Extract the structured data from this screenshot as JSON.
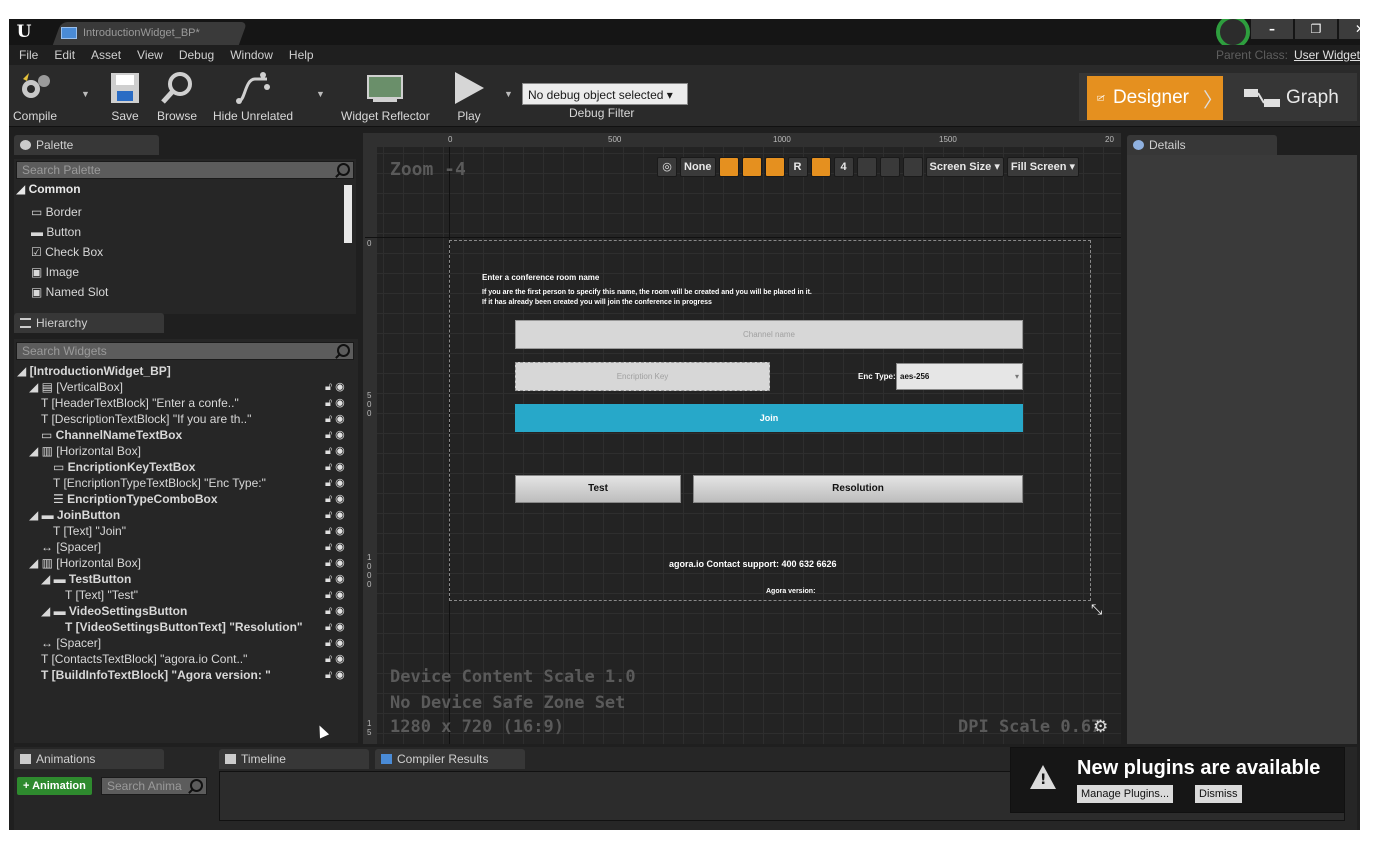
{
  "window": {
    "doc_tab": "IntroductionWidget_BP*",
    "controls": [
      "–",
      "❐",
      "✕"
    ]
  },
  "menu": [
    "File",
    "Edit",
    "Asset",
    "View",
    "Debug",
    "Window",
    "Help"
  ],
  "parent_class": {
    "label": "Parent Class:",
    "value": "User Widget"
  },
  "toolbar": {
    "compile": "Compile",
    "save": "Save",
    "browse": "Browse",
    "hide_unrelated": "Hide Unrelated",
    "widget_reflector": "Widget Reflector",
    "play": "Play",
    "debug_select": "No debug object selected ▾",
    "debug_filter": "Debug Filter",
    "designer": "Designer",
    "graph": "Graph"
  },
  "palette": {
    "tab": "Palette",
    "search_placeholder": "Search Palette",
    "category": "◢ Common",
    "items": [
      "▭ Border",
      "▬ Button",
      "☑ Check Box",
      "▣ Image",
      "▣ Named Slot"
    ]
  },
  "hierarchy": {
    "tab": "Hierarchy",
    "search_placeholder": "Search Widgets",
    "rows": [
      {
        "text": "◢ [IntroductionWidget_BP]",
        "indent": 0,
        "bold": true
      },
      {
        "text": "◢ ▤ [VerticalBox]",
        "indent": 1,
        "bold": false
      },
      {
        "text": "T [HeaderTextBlock] \"Enter a confe..\"",
        "indent": 2,
        "bold": false
      },
      {
        "text": "T [DescriptionTextBlock] \"If you are th..\"",
        "indent": 2,
        "bold": false
      },
      {
        "text": "▭ ChannelNameTextBox",
        "indent": 2,
        "bold": true
      },
      {
        "text": "◢ ▥ [Horizontal Box]",
        "indent": 1,
        "bold": false
      },
      {
        "text": "▭ EncriptionKeyTextBox",
        "indent": 3,
        "bold": true
      },
      {
        "text": "T [EncriptionTypeTextBlock] \"Enc Type:\"",
        "indent": 3,
        "bold": false
      },
      {
        "text": "☰ EncriptionTypeComboBox",
        "indent": 3,
        "bold": true
      },
      {
        "text": "◢ ▬ JoinButton",
        "indent": 1,
        "bold": true
      },
      {
        "text": "T [Text] \"Join\"",
        "indent": 3,
        "bold": false
      },
      {
        "text": "↔ [Spacer]",
        "indent": 2,
        "bold": false
      },
      {
        "text": "◢ ▥ [Horizontal Box]",
        "indent": 1,
        "bold": false
      },
      {
        "text": "◢ ▬ TestButton",
        "indent": 2,
        "bold": true
      },
      {
        "text": "T [Text] \"Test\"",
        "indent": 4,
        "bold": false
      },
      {
        "text": "◢ ▬ VideoSettingsButton",
        "indent": 2,
        "bold": true
      },
      {
        "text": "T [VideoSettingsButtonText] \"Resolution\"",
        "indent": 4,
        "bold": true
      },
      {
        "text": "↔ [Spacer]",
        "indent": 2,
        "bold": false
      },
      {
        "text": "T [ContactsTextBlock] \"agora.io Cont..\"",
        "indent": 2,
        "bold": false
      },
      {
        "text": "T [BuildInfoTextBlock] \"Agora version: \"",
        "indent": 2,
        "bold": true
      }
    ]
  },
  "canvas": {
    "zoom": "Zoom -4",
    "ruler_top": [
      "0",
      "500",
      "1000",
      "1500",
      "20"
    ],
    "ruler_left_a": [
      "0"
    ],
    "ruler_left_b": [
      "5",
      "0",
      "0"
    ],
    "ruler_left_c": [
      "1",
      "0",
      "0",
      "0"
    ],
    "ruler_left_d": [
      "1",
      "5"
    ],
    "toolbar": {
      "globe": "◎",
      "none": "None",
      "r": "R",
      "four": "4",
      "screen_size": "Screen Size ▾",
      "fill_screen": "Fill Screen ▾"
    },
    "device_scale": "Device Content Scale 1.0",
    "safe_zone": "No Device Safe Zone Set",
    "resolution": "1280 x 720 (16:9)",
    "dpi": "DPI Scale 0.67",
    "gear": "⚙"
  },
  "widget": {
    "header": "Enter a conference room name",
    "desc_line1": "If you are the first person to specify this name, the room will be created and you will be placed in it.",
    "desc_line2": "If it has already been created you will join the conference in progress",
    "channel_placeholder": "Channel name",
    "key_placeholder": "Encription Key",
    "enc_type_label": "Enc Type:",
    "enc_type_value": "aes-256",
    "join": "Join",
    "test": "Test",
    "resolution": "Resolution",
    "contacts": "agora.io Contact support: 400 632 6626",
    "version": "Agora version:"
  },
  "details": {
    "tab": "Details"
  },
  "bottom": {
    "animations_tab": "Animations",
    "timeline_tab": "Timeline",
    "compiler_tab": "Compiler Results",
    "add_animation": "+ Animation",
    "search_animation": "Search Anima"
  },
  "notification": {
    "title": "New plugins are available",
    "manage": "Manage Plugins...",
    "dismiss": "Dismiss"
  },
  "colors": {
    "accent_orange": "#e5901f",
    "join_blue": "#27a8c9",
    "animation_green": "#2e8a2e"
  }
}
